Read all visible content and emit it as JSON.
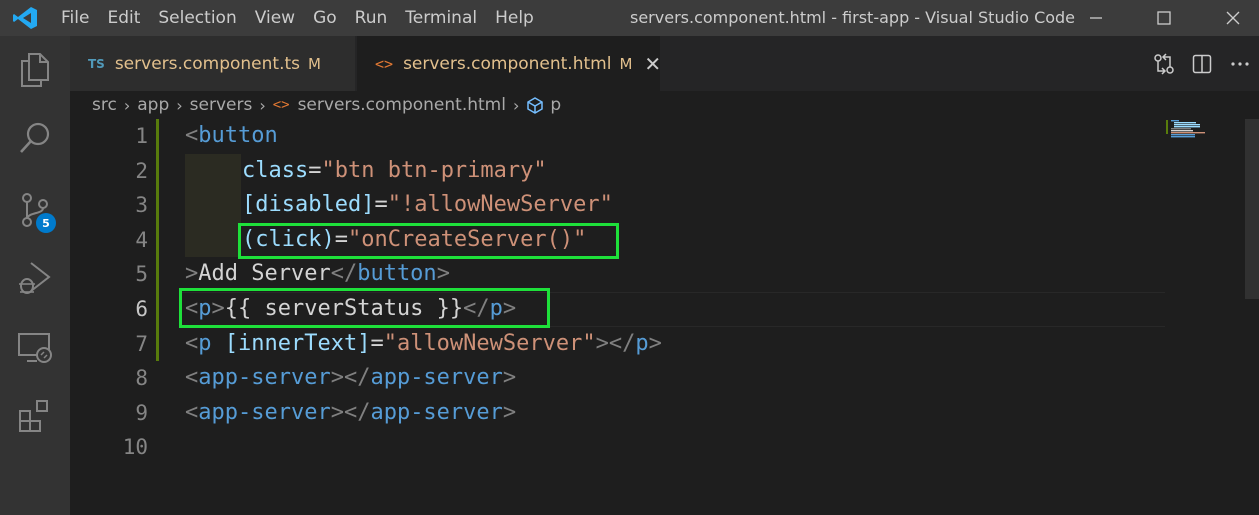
{
  "window": {
    "title": "servers.component.html - first-app - Visual Studio Code",
    "menu": [
      "File",
      "Edit",
      "Selection",
      "View",
      "Go",
      "Run",
      "Terminal",
      "Help"
    ]
  },
  "activity_bar": {
    "items": [
      "explorer-icon",
      "search-icon",
      "source-control-icon",
      "run-debug-icon",
      "remote-explorer-icon",
      "extensions-icon"
    ],
    "source_control_badge": "5"
  },
  "tabs": [
    {
      "badge": "TS",
      "name": "servers.component.ts",
      "status": "M"
    },
    {
      "badge": "<>",
      "name": "servers.component.html",
      "status": "M",
      "close": "✕"
    }
  ],
  "breadcrumb": {
    "parts": [
      "src",
      "app",
      "servers",
      "servers.component.html",
      "p"
    ],
    "separator": "›"
  },
  "editor": {
    "line_numbers": [
      "1",
      "2",
      "3",
      "4",
      "5",
      "6",
      "7",
      "8",
      "9",
      "10"
    ],
    "current_line": "6",
    "lines": {
      "l1": {
        "lt": "<",
        "tag": "button"
      },
      "l2": {
        "attr": "class",
        "eq": "=",
        "val": "\"btn btn-primary\""
      },
      "l3": {
        "attr": "[disabled]",
        "eq": "=",
        "val": "\"!allowNewServer\""
      },
      "l4": {
        "attr": "(click)",
        "eq": "=",
        "val": "\"onCreateServer()\""
      },
      "l5": {
        "gt": ">",
        "text": "Add Server",
        "close_open": "</",
        "tag": "button",
        "close_end": ">"
      },
      "l6": {
        "open": "<",
        "tag": "p",
        "gt": ">",
        "text": "{{ serverStatus }}",
        "close_open": "</",
        "close_tag": "p",
        "close_end": ">"
      },
      "l7": {
        "open": "<",
        "tag": "p",
        "space": " ",
        "attr": "[innerText]",
        "eq": "=",
        "val": "\"allowNewServer\"",
        "gt": ">",
        "close_open": "</",
        "close_tag": "p",
        "close_end": ">"
      },
      "l8": {
        "open": "<",
        "tag": "app-server",
        "gt": ">",
        "close_open": "</",
        "close_tag": "app-server",
        "close_end": ">"
      },
      "l9": {
        "open": "<",
        "tag": "app-server",
        "gt": ">",
        "close_open": "</",
        "close_tag": "app-server",
        "close_end": ">"
      }
    }
  },
  "colors": {
    "accent": "#007acc",
    "highlight_box": "#1ee03a",
    "modified_tab": "#e2c08d",
    "tag": "#569cd6",
    "attribute": "#9cdcfe",
    "string": "#ce9178"
  }
}
